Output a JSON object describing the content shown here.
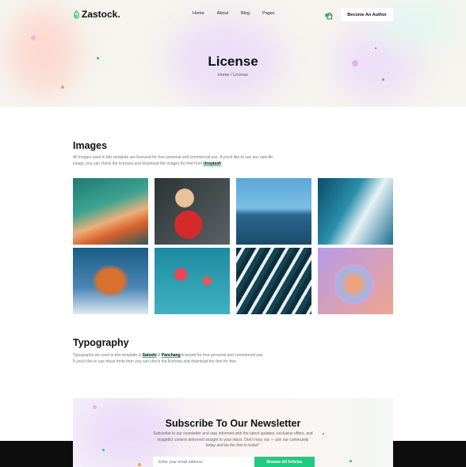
{
  "brand": {
    "name": "Zastock.",
    "accent": "#1ecb82"
  },
  "nav": {
    "items": [
      "Home",
      "About",
      "Blog",
      "Pages"
    ],
    "cart_count": "0",
    "cta": "Become An Author"
  },
  "hero": {
    "title": "License",
    "breadcrumb": "Home / License"
  },
  "images_section": {
    "heading": "Images",
    "text": "All images used in this template are licensed for free personal and commercial use. If you'd like to use any specific image, you can check the licenses and download the images for free from",
    "link": "Unsplash"
  },
  "gallery": [
    "illustration-city-tram",
    "woman-sunglasses-red-shirt",
    "man-on-sailboat",
    "ocean-waves-aerial",
    "red-fox-snow",
    "hot-air-balloons",
    "sea-foam-aerial",
    "gradient-sphere"
  ],
  "typography_section": {
    "heading": "Typography",
    "text_before": "Typography we used in this template is",
    "font1": "Satoshi",
    "amp": "&",
    "font2": "Panchang",
    "text_after": "licensed for free personal and commercial use.",
    "text_line2": "If you'd like to use these fonts then you can check the licenses and download the font for free."
  },
  "newsletter": {
    "title": "Subscribe To Our Newsletter",
    "text": "Subscribe to our newsletter and stay informed with the latest updates, exclusive offers, and insightful content delivered straight to your inbox. Don't miss out — join our community today and be the first to know!\"",
    "placeholder": "Enter your email address",
    "button": "Browse All Articles"
  }
}
